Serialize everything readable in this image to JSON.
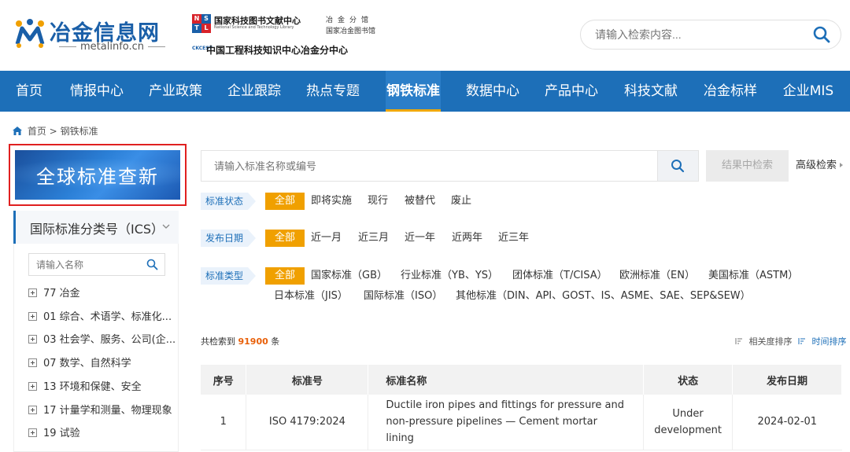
{
  "header": {
    "logo_title": "冶金信息网",
    "logo_sub": "metalinfo.cn",
    "nstl_name": "国家科技图书文献中心",
    "nstl_en": "National Science and Technology Library",
    "nstl_lib_line1": "冶金分馆",
    "nstl_lib_line2": "国家冶金图书馆",
    "ckcest_short": "CKCEST",
    "ckcest_name": "中国工程科技知识中心冶金分中心",
    "search_placeholder": "请输入检索内容..."
  },
  "nav": {
    "items": [
      "首页",
      "情报中心",
      "产业政策",
      "企业跟踪",
      "热点专题",
      "钢铁标准",
      "数据中心",
      "产品中心",
      "科技文献",
      "冶金标样",
      "企业MIS"
    ],
    "active_index": 5
  },
  "breadcrumb": {
    "home": "首页",
    "sep": ">",
    "current": "钢铁标准"
  },
  "sidebar": {
    "banner_text": "全球标准查新",
    "ics_title": "国际标准分类号（ICS）",
    "search_placeholder": "请输入名称",
    "tree": [
      "77 冶金",
      "01 综合、术语学、标准化...",
      "03 社会学、服务、公司(企...",
      "07 数学、自然科学",
      "13 环境和保健、安全",
      "17 计量学和测量、物理现象",
      "19 试验"
    ]
  },
  "search": {
    "placeholder": "请输入标准名称或编号",
    "result_search_label": "结果中检索",
    "advanced_label": "高级检索"
  },
  "filters": {
    "status": {
      "label": "标准状态",
      "options": [
        "全部",
        "即将实施",
        "现行",
        "被替代",
        "废止"
      ]
    },
    "date": {
      "label": "发布日期",
      "options": [
        "全部",
        "近一月",
        "近三月",
        "近一年",
        "近两年",
        "近三年"
      ]
    },
    "type": {
      "label": "标准类型",
      "options": [
        "全部",
        "国家标准（GB）",
        "行业标准（YB、YS）",
        "团体标准（T/CISA）",
        "欧洲标准（EN）",
        "美国标准（ASTM）",
        "日本标准（JIS）",
        "国际标准（ISO）",
        "其他标准（DIN、API、GOST、IS、ASME、SAE、SEP&SEW）"
      ]
    }
  },
  "results": {
    "count_prefix": "共检索到",
    "count": "91900",
    "count_suffix": "条",
    "sort_relevance": "相关度排序",
    "sort_time": "时间排序",
    "columns": [
      "序号",
      "标准号",
      "标准名称",
      "状态",
      "发布日期"
    ],
    "rows": [
      {
        "no": "1",
        "code": "ISO 4179:2024",
        "name": "Ductile iron pipes and fittings for pressure and non-pressure pipelines — Cement mortar lining",
        "status": "Under development",
        "date": "2024-02-01"
      }
    ]
  },
  "colors": {
    "nav_bg": "#1d6fb8",
    "accent": "#f0a000",
    "status_green": "#2e9a2e",
    "count_orange": "#e8600a",
    "highlight_red": "#e02020"
  }
}
